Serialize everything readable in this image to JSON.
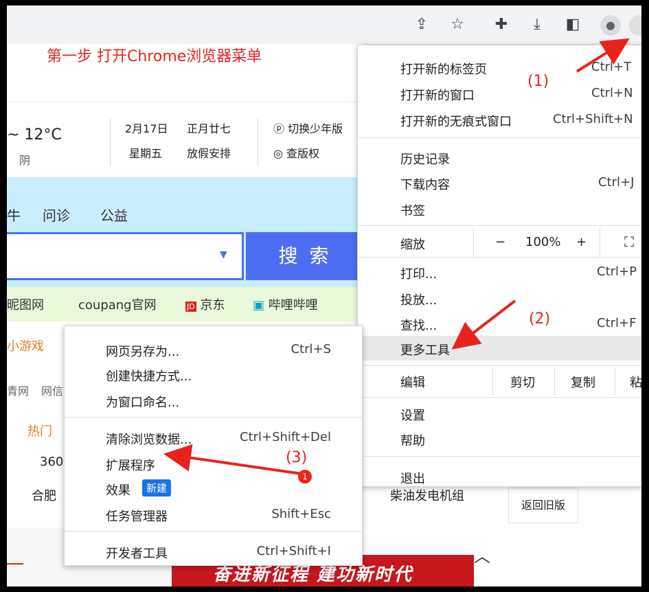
{
  "instruction": "第一步 打开Chrome浏览器菜单",
  "annotations": {
    "step1": "(1)",
    "step2": "(2)",
    "step3": "(3)",
    "dot": "1"
  },
  "toolbar": {
    "icons": [
      "share-icon",
      "star-icon",
      "extensions-icon",
      "download-icon",
      "sidepanel-icon",
      "profile-icon",
      "menu-icon"
    ]
  },
  "page": {
    "temp": "~ 12°C",
    "weather": "阴",
    "date": "2月17日",
    "lunar": "正月廿七",
    "weekday": "星期五",
    "holiday": "放假安排",
    "youth_mode": "切换少年版",
    "copyright": "查版权",
    "nav": [
      "牛",
      "问诊",
      "公益"
    ],
    "search_button": "搜 索",
    "quick_links": [
      "昵图网",
      "coupang官网",
      "京东",
      "哔哩哔哩"
    ],
    "games": "小游戏",
    "left_texts": [
      "青网",
      "网信"
    ],
    "hot": "热门",
    "city1": "360",
    "city2": "合肥",
    "ad1": "柴油发电机组",
    "revert": "返回旧版",
    "banner": "奋进新征程  建功新时代"
  },
  "menu": {
    "new_tab": "打开新的标签页",
    "new_tab_sc": "Ctrl+T",
    "new_window": "打开新的窗口",
    "new_window_sc": "Ctrl+N",
    "incognito": "打开新的无痕式窗口",
    "incognito_sc": "Ctrl+Shift+N",
    "history": "历史记录",
    "downloads": "下载内容",
    "downloads_sc": "Ctrl+J",
    "bookmarks": "书签",
    "zoom": "缩放",
    "zoom_minus": "−",
    "zoom_value": "100%",
    "zoom_plus": "+",
    "print": "打印...",
    "print_sc": "Ctrl+P",
    "cast": "投放...",
    "find": "查找...",
    "find_sc": "Ctrl+F",
    "more_tools": "更多工具",
    "edit": "编辑",
    "cut": "剪切",
    "copy": "复制",
    "paste": "粘",
    "settings": "设置",
    "help": "帮助",
    "exit": "退出"
  },
  "submenu": {
    "save_as": "网页另存为...",
    "save_as_sc": "Ctrl+S",
    "shortcut": "创建快捷方式...",
    "name_window": "为窗口命名...",
    "clear_data": "清除浏览数据...",
    "clear_data_sc": "Ctrl+Shift+Del",
    "extensions": "扩展程序",
    "effects": "效果",
    "effects_badge": "新建",
    "task_manager": "任务管理器",
    "task_manager_sc": "Shift+Esc",
    "dev_tools": "开发者工具",
    "dev_tools_sc": "Ctrl+Shift+I"
  }
}
